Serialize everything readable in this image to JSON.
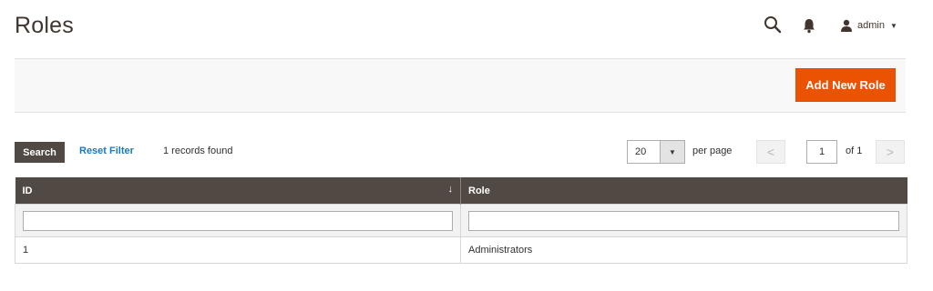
{
  "header": {
    "title": "Roles",
    "user": {
      "name": "admin"
    }
  },
  "actions": {
    "add_new_role": "Add New Role"
  },
  "toolbar": {
    "search_label": "Search",
    "reset_filter_label": "Reset Filter",
    "records_found": "1 records found",
    "per_page_value": "20",
    "per_page_label": "per page",
    "prev_symbol": "<",
    "next_symbol": ">",
    "current_page": "1",
    "of_total": "of 1"
  },
  "table": {
    "columns": [
      {
        "label": "ID",
        "sort_indicator": "↓"
      },
      {
        "label": "Role"
      }
    ],
    "rows": [
      {
        "id": "1",
        "role": "Administrators"
      }
    ]
  },
  "icons": {
    "search": "search-icon",
    "notifications": "bell-icon",
    "user": "user-icon",
    "user_dropdown": "caret-down-icon",
    "per_page_dropdown": "caret-down-icon"
  },
  "colors": {
    "accent": "#eb5202",
    "table_header": "#514943",
    "link": "#1979c3",
    "title": "#41362f"
  }
}
